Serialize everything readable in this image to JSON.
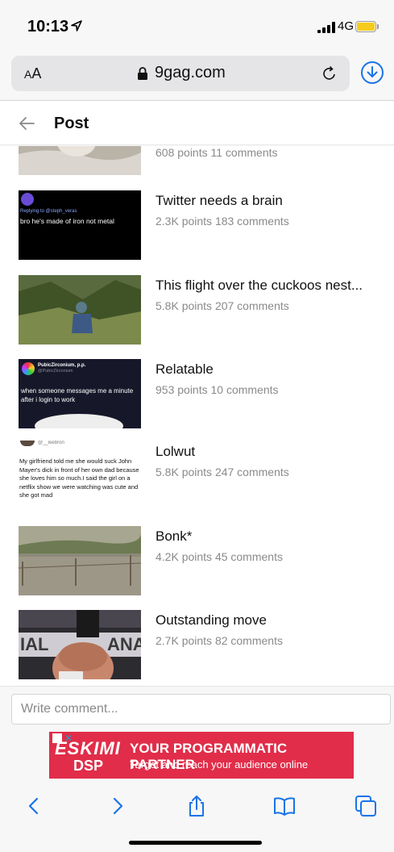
{
  "status": {
    "time": "10:13",
    "network": "4G"
  },
  "browser": {
    "text_size": "AA",
    "domain": "9gag.com"
  },
  "page": {
    "title": "Post"
  },
  "posts": [
    {
      "title": "",
      "meta": "608 points 11 comments"
    },
    {
      "title": "Twitter needs a brain",
      "meta": "2.3K points 183 comments",
      "thumb_text": "bro he's made of iron not metal",
      "thumb_reply": "Replying to @steph_veras"
    },
    {
      "title": "This flight over the cuckoos nest...",
      "meta": "5.8K points 207 comments"
    },
    {
      "title": "Relatable",
      "meta": "953 points 10 comments",
      "thumb_name": "PubicZirconium, p.p.",
      "thumb_handle": "@PubicZirconium",
      "thumb_text": "when someone messages me a minute after i login to work"
    },
    {
      "title": "Lolwut",
      "meta": "5.8K points 247 comments",
      "thumb_handle": "@__leebron",
      "thumb_text": "My girlfriend told me she would suck John Mayer's dick in front of her own dad because she loves him so much.I said the girl on a netflix show we were watching was cute and she got mad"
    },
    {
      "title": "Bonk*",
      "meta": "4.2K points 45 comments"
    },
    {
      "title": "Outstanding move",
      "meta": "2.7K points 82 comments"
    }
  ],
  "comment": {
    "placeholder": "Write comment..."
  },
  "ad": {
    "brand": "ESKIMI",
    "brand_sub": "DSP",
    "headline": "YOUR PROGRAMMATIC PARTNER",
    "sub": "Target and reach your audience online"
  },
  "toolbar_icons": [
    "back-icon",
    "forward-icon",
    "share-icon",
    "bookmarks-icon",
    "tabs-icon"
  ],
  "colors": {
    "accent": "#1a73e8",
    "ad_bg": "#e12d49",
    "battery": "#f5cc1d"
  }
}
